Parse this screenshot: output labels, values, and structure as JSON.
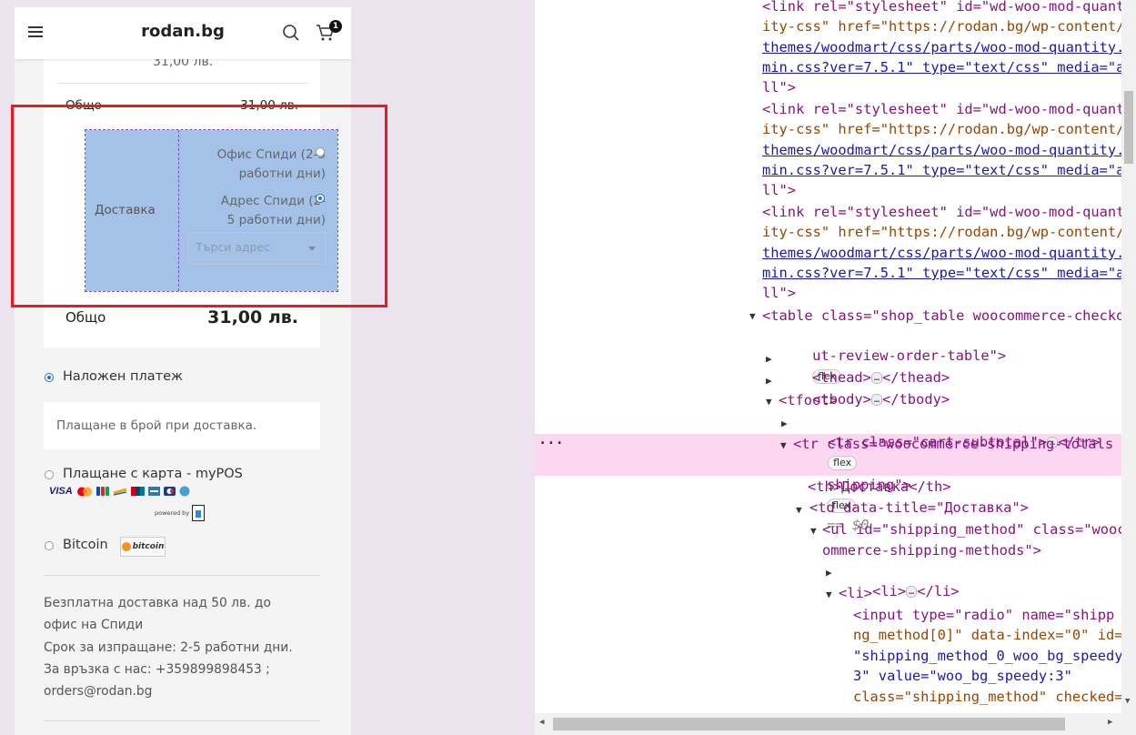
{
  "site": {
    "logo": "rodan.bg",
    "cart_count": "1"
  },
  "order": {
    "cut_price": "31,00 лв.",
    "subtotal_label": "Общо",
    "subtotal_value": "31,00 лв.",
    "shipping_label": "Доставка",
    "shipping_options": [
      {
        "line1": "Офис Спиди (2-5",
        "line2": "работни дни)",
        "checked": false
      },
      {
        "line1": "Адрес Спиди (2-",
        "line2": "5 работни дни)",
        "checked": true
      }
    ],
    "address_placeholder": "Търси адрес",
    "total_label": "Общо",
    "total_value": "31,00 лв."
  },
  "payment": {
    "cod_label": "Наложен платеж",
    "cod_desc": "Плащане в брой при доставка.",
    "card_label": "Плащане с карта - myPOS",
    "card_brands": [
      "VISA",
      "MC",
      "JCB",
      "Maestro",
      "UnionPay",
      "Diners",
      "AmEx",
      "Discover"
    ],
    "powered_by": "powered by",
    "bitcoin_label": "Bitcoin",
    "bitcoin_logo": "bitcoin"
  },
  "info_text": [
    "Безплатна доставка над 50 лв. до",
    "офис на Спиди",
    "Срок за изпращане: 2-5 работни дни.",
    "За връзка с нас: +359899898453 ;",
    "orders@rodan.bg"
  ],
  "devtools": {
    "link_lines": [
      "<link rel=\"stylesheet\" id=\"wd-woo-mod-quant",
      "ity-css\" href=\"https://rodan.bg/wp-content/",
      "themes/woodmart/css/parts/woo-mod-quantity.",
      "min.css?ver=7.5.1\" type=\"text/css\" media=\"a",
      "ll\">"
    ],
    "table_open": "<table class=\"shop_table woocommerce-checko",
    "table_open_2": "ut-review-order-table\">",
    "thead": "<thead>",
    "thead_close": "</thead>",
    "tbody": "<tbody>",
    "tbody_close": "</tbody>",
    "tfoot": "<tfoot>",
    "tr_subtotal": "<tr class=\"cart-subtotal\">",
    "tr_close": "</tr>",
    "tr_shipping": "<tr class=\"woocommerce-shipping-totals",
    "tr_shipping_2": "shipping\">",
    "flex_badge": "flex",
    "eq_dollar": "== $0",
    "th_line": "<th>Доставка</th>",
    "td_line": "<td data-title=\"Доставка\">",
    "ul_line": "<ul id=\"shipping_method\" class=\"wooc",
    "ul_line_2": "ommerce-shipping-methods\">",
    "li_collapsed": "<li>",
    "li_close": "</li>",
    "li_open": "<li>",
    "input_lines": [
      "<input type=\"radio\" name=\"shipp",
      "ng_method[0]\" data-index=\"0\" id=",
      "\"shipping_method_0_woo_bg_speedy",
      "3\" value=\"woo_bg_speedy:3\"",
      "class=\"shipping_method\" checked="
    ],
    "more_dots": "…"
  }
}
